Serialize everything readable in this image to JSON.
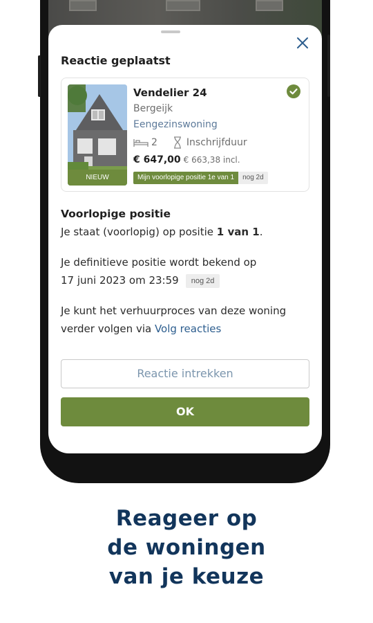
{
  "colors": {
    "accent_green": "#6e8b3d",
    "link_blue": "#2c5d8e",
    "caption_navy": "#12355b"
  },
  "sheet": {
    "title": "Reactie geplaatst",
    "close_icon": "close-icon"
  },
  "listing": {
    "street": "Vendelier 24",
    "city": "Bergeijk",
    "type": "Eengezinswoning",
    "bedrooms": "2",
    "criterion": "Inschrijfduur",
    "price": "€ 647,00",
    "price_incl": "€ 663,38 incl.",
    "nieuw_tag": "NIEUW",
    "position_badge": "Mijn voorlopige positie 1e van 1",
    "time_left_badge": "nog 2d",
    "status_icon": "check-circle-icon"
  },
  "position": {
    "title": "Voorlopige positie",
    "line1_prefix": "Je staat (voorlopig) op positie ",
    "line1_value": "1 van 1",
    "line1_suffix": ".",
    "line2": "Je definitieve positie wordt bekend op",
    "line2_date": "17 juni 2023 om 23:59",
    "line2_badge": "nog 2d",
    "line3": "Je kunt het verhuurproces van deze woning verder volgen via ",
    "line3_link": "Volg reacties"
  },
  "buttons": {
    "withdraw": "Reactie intrekken",
    "ok": "OK"
  },
  "caption": {
    "line1": "Reageer op",
    "line2": "de woningen",
    "line3": "van je keuze"
  }
}
